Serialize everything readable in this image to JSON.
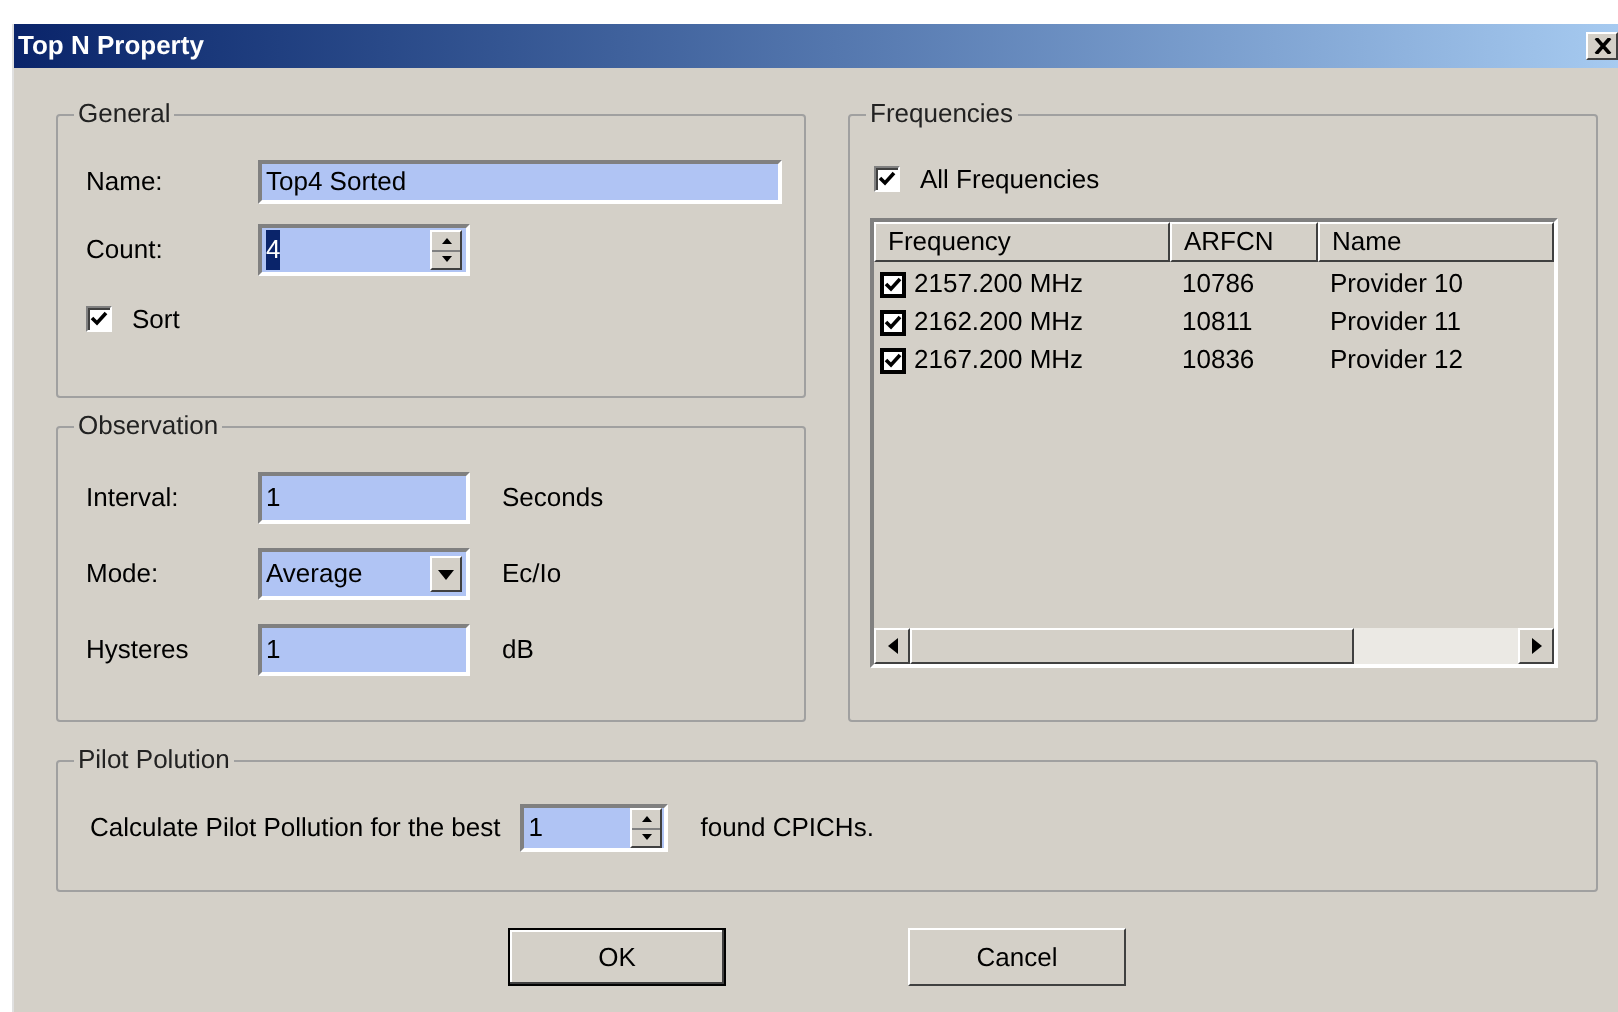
{
  "window": {
    "title": "Top N Property"
  },
  "general": {
    "title": "General",
    "name": {
      "label": "Name:",
      "value": "Top4 Sorted"
    },
    "count": {
      "label": "Count:",
      "value": "4",
      "highlighted": true
    },
    "sort": {
      "label": "Sort",
      "checked": true
    }
  },
  "observation": {
    "title": "Observation",
    "fields": [
      {
        "kind": "text",
        "label": "Interval:",
        "value": "1",
        "unit": "Seconds"
      },
      {
        "kind": "dropdown",
        "label": "Mode:",
        "value": "Average",
        "unit": "Ec/Io"
      },
      {
        "kind": "text",
        "label": "Hysteres",
        "value": "1",
        "unit": "dB"
      }
    ]
  },
  "frequencies": {
    "title": "Frequencies",
    "all": {
      "label": "All Frequencies",
      "checked": true
    },
    "columns": [
      "Frequency",
      "ARFCN",
      "Name"
    ],
    "rows": [
      {
        "frequency": "2157.200 MHz",
        "arfcn": "10786",
        "name": "Provider 10",
        "checked": true
      },
      {
        "frequency": "2162.200 MHz",
        "arfcn": "10811",
        "name": "Provider 11",
        "checked": true
      },
      {
        "frequency": "2167.200 MHz",
        "arfcn": "10836",
        "name": "Provider 12",
        "checked": true
      }
    ]
  },
  "pilot_polution": {
    "title": "Pilot Polution",
    "prefix": "Calculate Pilot Pollution for the best",
    "value": "1",
    "suffix": "found CPICHs."
  },
  "buttons": [
    {
      "label": "OK",
      "default": true
    },
    {
      "label": "Cancel",
      "default": false
    }
  ]
}
